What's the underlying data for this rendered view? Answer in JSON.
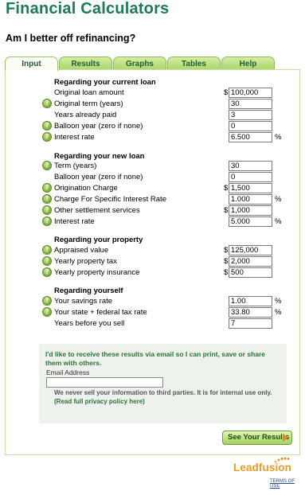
{
  "header": {
    "title": "Financial Calculators",
    "subtitle": "Am I better off refinancing?"
  },
  "tabs": [
    {
      "label": "Input",
      "active": true
    },
    {
      "label": "Results",
      "active": false
    },
    {
      "label": "Graphs",
      "active": false
    },
    {
      "label": "Tables",
      "active": false
    },
    {
      "label": "Help",
      "active": false
    }
  ],
  "sections": {
    "current_loan": {
      "heading": "Regarding your current loan",
      "original_loan_amount": {
        "label": "Original loan amount",
        "value": "100,000",
        "prefix": "$"
      },
      "original_term": {
        "label": "Original term (years)",
        "value": "30"
      },
      "years_already_paid": {
        "label": "Years already paid",
        "value": "3"
      },
      "balloon_year": {
        "label": "Balloon year (zero if none)",
        "value": "0"
      },
      "interest_rate": {
        "label": "Interest rate",
        "value": "6.500",
        "suffix": "%"
      }
    },
    "new_loan": {
      "heading": "Regarding your new loan",
      "term": {
        "label": "Term (years)",
        "value": "30"
      },
      "balloon_year": {
        "label": "Balloon year (zero if none)",
        "value": "0"
      },
      "origination_charge": {
        "label": "Origination Charge",
        "value": "1,500",
        "prefix": "$"
      },
      "charge_specific_rate": {
        "label": "Charge For Specific Interest Rate",
        "value": "1.000",
        "suffix": "%"
      },
      "other_settlement": {
        "label": "Other settlement services",
        "value": "1,000",
        "prefix": "$"
      },
      "interest_rate": {
        "label": "Interest rate",
        "value": "5.000",
        "suffix": "%"
      }
    },
    "property": {
      "heading": "Regarding your property",
      "appraised_value": {
        "label": "Appraised value",
        "value": "125,000",
        "prefix": "$"
      },
      "yearly_tax": {
        "label": "Yearly property tax",
        "value": "2,000",
        "prefix": "$"
      },
      "yearly_insurance": {
        "label": "Yearly property insurance",
        "value": "500",
        "prefix": "$"
      }
    },
    "yourself": {
      "heading": "Regarding yourself",
      "savings_rate": {
        "label": "Your savings rate",
        "value": "1.00",
        "suffix": "%"
      },
      "tax_rate": {
        "label": "Your state + federal tax rate",
        "value": "33.80",
        "suffix": "%"
      },
      "years_before_sell": {
        "label": "Years before you sell",
        "value": "7"
      }
    }
  },
  "email": {
    "heading": "I'd like to receive these results via email so I can print, save or share them with others.",
    "label": "Email Address",
    "value": "",
    "privacy_text": "We never sell your information to third parties. It is for internal use only.",
    "privacy_link": "(Read full privacy policy here)"
  },
  "actions": {
    "see_results_label": "See Your Results"
  },
  "branding": {
    "logo_text": "Leadfusion",
    "terms_link": "TERMS OF USE"
  },
  "colors": {
    "title": "#1f7a55",
    "tab_green": "#a9d66a",
    "accent_orange": "#e89a24"
  },
  "icons": {
    "help": "help-icon",
    "arrow": "arrow-right-icon"
  }
}
